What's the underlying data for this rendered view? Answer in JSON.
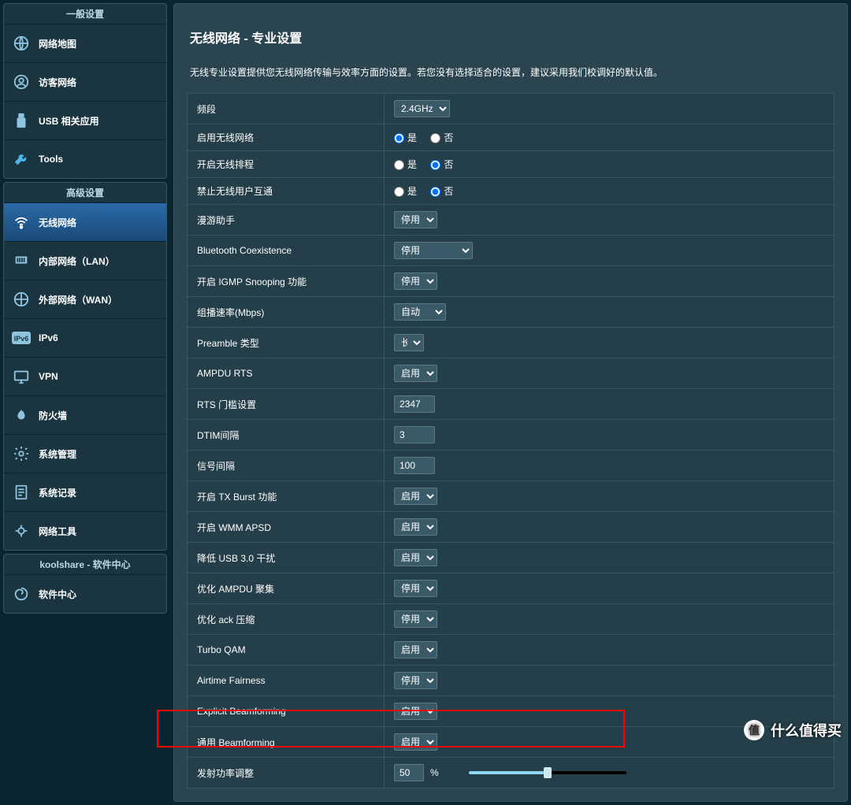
{
  "sidebar": {
    "group1": {
      "header": "一般设置",
      "items": [
        {
          "icon": "globe",
          "label": "网络地图"
        },
        {
          "icon": "guest",
          "label": "访客网络"
        },
        {
          "icon": "usb",
          "label": "USB 相关应用"
        },
        {
          "icon": "wrench",
          "label": "Tools"
        }
      ]
    },
    "group2": {
      "header": "高级设置",
      "items": [
        {
          "icon": "wifi",
          "label": "无线网络",
          "active": true
        },
        {
          "icon": "lan",
          "label": "内部网络（LAN）"
        },
        {
          "icon": "wan",
          "label": "外部网络（WAN）"
        },
        {
          "icon": "ipv6",
          "label": "IPv6"
        },
        {
          "icon": "vpn",
          "label": "VPN"
        },
        {
          "icon": "fire",
          "label": "防火墙"
        },
        {
          "icon": "gear",
          "label": "系统管理"
        },
        {
          "icon": "log",
          "label": "系统记录"
        },
        {
          "icon": "tools",
          "label": "网络工具"
        }
      ]
    },
    "group3": {
      "header": "koolshare - 软件中心",
      "items": [
        {
          "icon": "spiral",
          "label": "软件中心"
        }
      ]
    }
  },
  "main": {
    "title": "无线网络 - 专业设置",
    "desc": "无线专业设置提供您无线网络传输与效率方面的设置。若您没有选择适合的设置，建议采用我们校调好的默认值。",
    "radioYes": "是",
    "radioNo": "否",
    "rows": {
      "band": {
        "label": "频段",
        "value": "2.4GHz"
      },
      "enableWifi": {
        "label": "启用无线网络",
        "value": "是"
      },
      "schedule": {
        "label": "开启无线排程",
        "value": "否"
      },
      "isolate": {
        "label": "禁止无线用户互通",
        "value": "否"
      },
      "roaming": {
        "label": "漫游助手",
        "value": "停用"
      },
      "bluetooth": {
        "label": "Bluetooth Coexistence",
        "value": "停用"
      },
      "igmp": {
        "label": "开启 IGMP Snooping 功能",
        "value": "停用"
      },
      "multicast": {
        "label": "组播速率(Mbps)",
        "value": "自动"
      },
      "preamble": {
        "label": "Preamble 类型",
        "value": "长"
      },
      "ampduRts": {
        "label": "AMPDU RTS",
        "value": "启用"
      },
      "rts": {
        "label": "RTS 门槛设置",
        "value": "2347"
      },
      "dtim": {
        "label": "DTIM间隔",
        "value": "3"
      },
      "beacon": {
        "label": "信号间隔",
        "value": "100"
      },
      "txburst": {
        "label": "开启 TX Burst 功能",
        "value": "启用"
      },
      "wmm": {
        "label": "开启 WMM APSD",
        "value": "启用"
      },
      "usb3": {
        "label": "降低 USB 3.0 干扰",
        "value": "启用"
      },
      "ampduAgg": {
        "label": "优化 AMPDU 聚集",
        "value": "停用"
      },
      "ack": {
        "label": "优化 ack 压缩",
        "value": "停用"
      },
      "turbo": {
        "label": "Turbo QAM",
        "value": "启用"
      },
      "airtime": {
        "label": "Airtime Fairness",
        "value": "停用"
      },
      "explicitBf": {
        "label": "Explicit Beamforming",
        "value": "启用"
      },
      "universalBf": {
        "label": "通用 Beamforming",
        "value": "启用"
      },
      "txpower": {
        "label": "发射功率调整",
        "value": "50",
        "unit": "%"
      }
    }
  },
  "watermark": {
    "badge": "值",
    "text": "什么值得买"
  }
}
